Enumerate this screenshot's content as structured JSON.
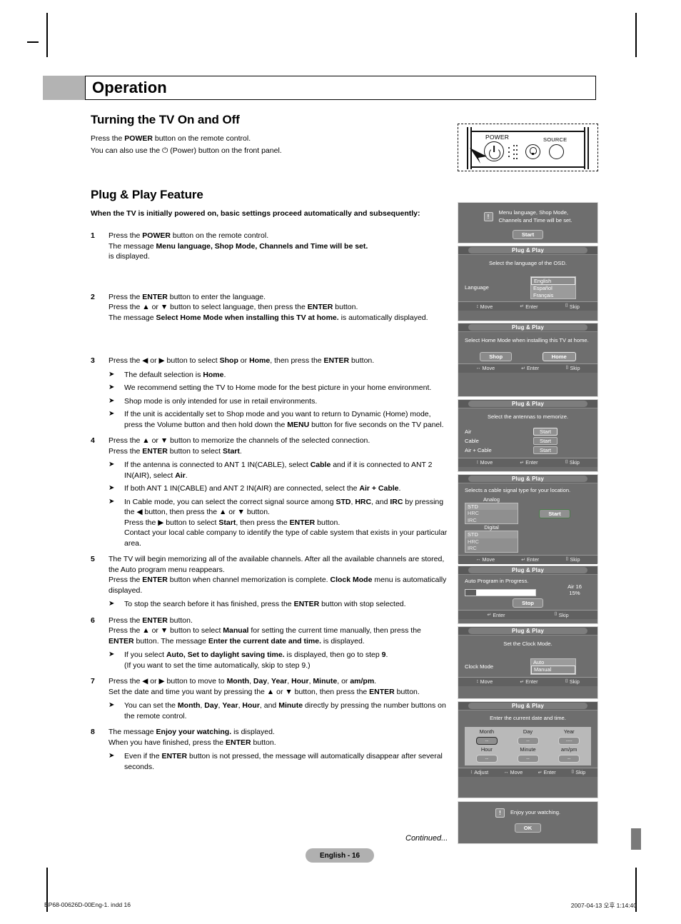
{
  "chapter": {
    "title": "Operation"
  },
  "sections": {
    "power": {
      "heading": "Turning the TV On and Off",
      "line1_a": "Press the ",
      "line1_b": "POWER",
      "line1_c": " button on the remote control.",
      "line2_a": "You can also use the ",
      "line2_b": " (Power) button on the front panel."
    },
    "plugplay": {
      "heading": "Plug & Play Feature",
      "lead": "When the TV is initially powered on, basic settings proceed automatically and subsequently:"
    }
  },
  "steps": [
    {
      "num": "1",
      "lines": [
        "Press the |POWER| button on the remote control.",
        "The message |Menu language, Shop Mode, Channels and Time will be set.|",
        "is displayed."
      ],
      "bullets": []
    },
    {
      "num": "2",
      "lines": [
        "Press the |ENTER| button to enter the language.",
        "Press the ▲ or ▼ button to select language, then press the |ENTER| button.",
        "The message |Select Home Mode when installing this TV at home.| is automatically displayed."
      ],
      "bullets": []
    },
    {
      "num": "3",
      "lines": [
        "Press the ◀ or ▶ button to select |Shop| or |Home|, then press the |ENTER| button."
      ],
      "bullets": [
        "The default selection is |Home|.",
        "We recommend setting the TV to Home mode for the best picture in your home environment.",
        "Shop mode is only intended for use in retail environments.",
        "If the unit is accidentally set to Shop mode and you want to return to Dynamic (Home) mode, press the Volume button and then hold down the |MENU| button for five seconds on the TV panel."
      ]
    },
    {
      "num": "4",
      "lines": [
        "Press the ▲ or ▼ button to memorize the channels of the selected connection.",
        "Press the |ENTER| button to select |Start|."
      ],
      "bullets": [
        "If the antenna is connected to ANT 1 IN(CABLE), select |Cable| and if it is connected to ANT 2 IN(AIR), select |Air|.",
        "If both ANT 1 IN(CABLE) and ANT 2 IN(AIR) are connected, select the |Air + Cable|.",
        "In Cable mode, you can select the correct signal source among |STD|, |HRC|, and |IRC| by pressing the ◀ button, then press the ▲ or ▼ button.\nPress the ▶ button to select |Start|, then press the |ENTER| button.\nContact your local cable company to identify the type of cable system that exists in your particular area."
      ]
    },
    {
      "num": "5",
      "lines": [
        "The TV will begin memorizing all of the available channels. After all the available channels are stored, the Auto program menu reappears.",
        "Press the |ENTER| button when channel memorization is complete. |Clock Mode| menu is automatically displayed."
      ],
      "bullets": [
        "To stop the search before it has finished, press the |ENTER| button with stop selected."
      ]
    },
    {
      "num": "6",
      "lines": [
        "Press the |ENTER| button.",
        "Press the ▲ or ▼ button to select |Manual| for setting the current time manually, then press the |ENTER| button. The message |Enter the current date and time.| is displayed."
      ],
      "bullets": [
        "If you select |Auto, Set to daylight saving time.| is displayed, then go to step |9|.\n(If you want to set the time automatically, skip to step 9.)"
      ]
    },
    {
      "num": "7",
      "lines": [
        "Press the ◀ or ▶ button to move to |Month|, |Day|, |Year|, |Hour|, |Minute|, or |am/pm|.",
        "Set the date and time you want by pressing the ▲ or ▼ button, then press the |ENTER| button."
      ],
      "bullets": [
        "You can set the |Month|, |Day|, |Year|, |Hour|, and |Minute| directly by pressing the number buttons on the remote control."
      ]
    },
    {
      "num": "8",
      "lines": [
        "The message |Enjoy your watching.| is displayed.",
        "When you have finished, press the |ENTER| button."
      ],
      "bullets": [
        "Even if the |ENTER| button is not pressed, the message will automatically disappear after several seconds."
      ]
    }
  ],
  "remote_diagram": {
    "power_label": "POWER",
    "source_label": "SOURCE"
  },
  "osd_screens": [
    {
      "id": "intro",
      "has_title": false,
      "message": "Menu language, Shop Mode,\nChannels and Time will be set.",
      "button": "Start",
      "icon": "info-icon"
    },
    {
      "id": "language",
      "has_title": true,
      "title": "Plug & Play",
      "message": "Select the language of the OSD.",
      "field_label": "Language",
      "options": [
        "English",
        "Español",
        "Français"
      ],
      "selected": "English",
      "footer": [
        {
          "icon": "updown-icon",
          "label": "Move"
        },
        {
          "icon": "enter-icon",
          "label": "Enter"
        },
        {
          "icon": "exit-icon",
          "label": "Skip"
        }
      ]
    },
    {
      "id": "home_mode",
      "has_title": true,
      "title": "Plug & Play",
      "message": "Select Home Mode when installing this TV at home.",
      "buttons": [
        "Shop",
        "Home"
      ],
      "selected": "Home",
      "footer": [
        {
          "icon": "leftright-icon",
          "label": "Move"
        },
        {
          "icon": "enter-icon",
          "label": "Enter"
        },
        {
          "icon": "exit-icon",
          "label": "Skip"
        }
      ]
    },
    {
      "id": "antenna",
      "has_title": true,
      "title": "Plug & Play",
      "message": "Select the antennas to memorize.",
      "rows": [
        {
          "label": "Air",
          "button": "Start",
          "selected": true
        },
        {
          "label": "Cable",
          "button": "Start",
          "selected": false
        },
        {
          "label": "Air + Cable",
          "button": "Start",
          "selected": false
        }
      ],
      "footer": [
        {
          "icon": "updown-icon",
          "label": "Move"
        },
        {
          "icon": "enter-icon",
          "label": "Enter"
        },
        {
          "icon": "exit-icon",
          "label": "Skip"
        }
      ]
    },
    {
      "id": "cable_signal",
      "has_title": true,
      "title": "Plug & Play",
      "message": "Selects a cable signal type for your location.",
      "group_analog": "Analog",
      "group_digital": "Digital",
      "signal_options": [
        "STD",
        "HRC",
        "IRC"
      ],
      "analog_selected": "STD",
      "digital_selected": "STD",
      "button": "Start",
      "footer": [
        {
          "icon": "leftright-icon",
          "label": "Move"
        },
        {
          "icon": "enter-icon",
          "label": "Enter"
        },
        {
          "icon": "exit-icon",
          "label": "Skip"
        }
      ]
    },
    {
      "id": "auto_program",
      "has_title": true,
      "title": "Plug & Play",
      "message": "Auto Program in Progress.",
      "channel": "Air 16",
      "percent": "15%",
      "progress_value": 15,
      "button": "Stop",
      "footer": [
        {
          "icon": "enter-icon",
          "label": "Enter"
        },
        {
          "icon": "exit-icon",
          "label": "Skip"
        }
      ]
    },
    {
      "id": "clock_mode",
      "has_title": true,
      "title": "Plug & Play",
      "message": "Set the Clock Mode.",
      "field_label": "Clock Mode",
      "options": [
        "Auto",
        "Manual"
      ],
      "selected": "Manual",
      "footer": [
        {
          "icon": "updown-icon",
          "label": "Move"
        },
        {
          "icon": "enter-icon",
          "label": "Enter"
        },
        {
          "icon": "exit-icon",
          "label": "Skip"
        }
      ]
    },
    {
      "id": "date_time",
      "has_title": true,
      "title": "Plug & Play",
      "message": "Enter the current date and time.",
      "headers_row1": [
        "Month",
        "Day",
        "Year"
      ],
      "values_row1": [
        "--",
        "--",
        "----"
      ],
      "headers_row2": [
        "Hour",
        "Minute",
        "am/pm"
      ],
      "values_row2": [
        "--",
        "--",
        "--"
      ],
      "selected_field": "Month",
      "footer": [
        {
          "icon": "updown-icon",
          "label": "Adjust"
        },
        {
          "icon": "leftright-icon",
          "label": "Move"
        },
        {
          "icon": "enter-icon",
          "label": "Enter"
        },
        {
          "icon": "exit-icon",
          "label": "Skip"
        }
      ]
    },
    {
      "id": "enjoy",
      "has_title": false,
      "message": "Enjoy your watching.",
      "button": "OK",
      "icon": "info-icon"
    }
  ],
  "footer": {
    "continued": "Continued...",
    "page_label": "English - 16",
    "print_left": "BP68-00626D-00Eng-1. indd   16",
    "print_right": "2007-04-13   오후 1:14:40"
  }
}
